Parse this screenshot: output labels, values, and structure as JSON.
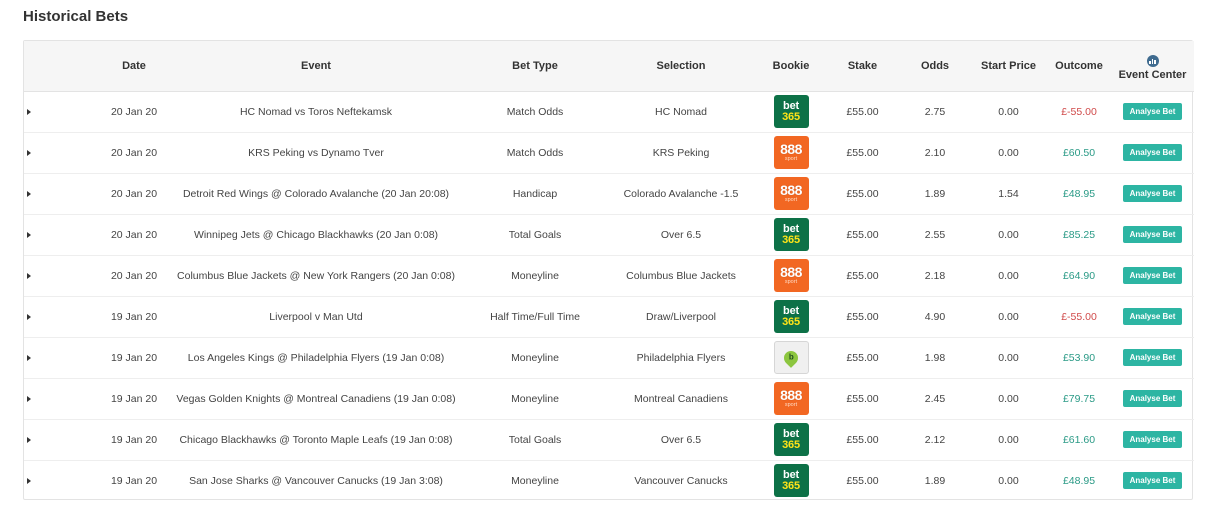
{
  "page": {
    "title": "Historical Bets"
  },
  "table": {
    "headers": {
      "date": "Date",
      "event": "Event",
      "bet_type": "Bet Type",
      "selection": "Selection",
      "bookie": "Bookie",
      "stake": "Stake",
      "odds": "Odds",
      "start_price": "Start Price",
      "outcome": "Outcome",
      "event_center": "Event Center"
    },
    "event_center_icon": "bar-chart-icon",
    "button_label": "Analyse Bet",
    "colors": {
      "negative": "#d04a4a",
      "positive": "#2a9a86",
      "button": "#2db5a3"
    },
    "rows": [
      {
        "date": "20 Jan 20",
        "event": "HC Nomad vs Toros Neftekamsk",
        "bet_type": "Match Odds",
        "selection": "HC Nomad",
        "bookie": "bet365",
        "bookie_l1": "bet",
        "bookie_l2": "365",
        "stake": "£55.00",
        "odds": "2.75",
        "start_price": "0.00",
        "outcome": "£-55.00",
        "outcome_type": "negative"
      },
      {
        "date": "20 Jan 20",
        "event": "KRS Peking vs Dynamo Tver",
        "bet_type": "Match Odds",
        "selection": "KRS Peking",
        "bookie": "888",
        "bookie_l1": "888",
        "bookie_l2": "sport",
        "stake": "£55.00",
        "odds": "2.10",
        "start_price": "0.00",
        "outcome": "£60.50",
        "outcome_type": "positive"
      },
      {
        "date": "20 Jan 20",
        "event": "Detroit Red Wings @ Colorado Avalanche (20 Jan 20:08)",
        "bet_type": "Handicap",
        "selection": "Colorado Avalanche -1.5",
        "bookie": "888",
        "bookie_l1": "888",
        "bookie_l2": "sport",
        "stake": "£55.00",
        "odds": "1.89",
        "start_price": "1.54",
        "outcome": "£48.95",
        "outcome_type": "positive"
      },
      {
        "date": "20 Jan 20",
        "event": "Winnipeg Jets @ Chicago Blackhawks (20 Jan 0:08)",
        "bet_type": "Total Goals",
        "selection": "Over 6.5",
        "bookie": "bet365",
        "bookie_l1": "bet",
        "bookie_l2": "365",
        "stake": "£55.00",
        "odds": "2.55",
        "start_price": "0.00",
        "outcome": "£85.25",
        "outcome_type": "positive"
      },
      {
        "date": "20 Jan 20",
        "event": "Columbus Blue Jackets @ New York Rangers (20 Jan 0:08)",
        "bet_type": "Moneyline",
        "selection": "Columbus Blue Jackets",
        "bookie": "888",
        "bookie_l1": "888",
        "bookie_l2": "sport",
        "stake": "£55.00",
        "odds": "2.18",
        "start_price": "0.00",
        "outcome": "£64.90",
        "outcome_type": "positive"
      },
      {
        "date": "19 Jan 20",
        "event": "Liverpool v Man Utd",
        "bet_type": "Half Time/Full Time",
        "selection": "Draw/Liverpool",
        "bookie": "bet365",
        "bookie_l1": "bet",
        "bookie_l2": "365",
        "stake": "£55.00",
        "odds": "4.90",
        "start_price": "0.00",
        "outcome": "£-55.00",
        "outcome_type": "negative"
      },
      {
        "date": "19 Jan 20",
        "event": "Los Angeles Kings @ Philadelphia Flyers (19 Jan 0:08)",
        "bet_type": "Moneyline",
        "selection": "Philadelphia Flyers",
        "bookie": "pin",
        "bookie_l1": "",
        "bookie_l2": "",
        "stake": "£55.00",
        "odds": "1.98",
        "start_price": "0.00",
        "outcome": "£53.90",
        "outcome_type": "positive"
      },
      {
        "date": "19 Jan 20",
        "event": "Vegas Golden Knights @ Montreal Canadiens (19 Jan 0:08)",
        "bet_type": "Moneyline",
        "selection": "Montreal Canadiens",
        "bookie": "888",
        "bookie_l1": "888",
        "bookie_l2": "sport",
        "stake": "£55.00",
        "odds": "2.45",
        "start_price": "0.00",
        "outcome": "£79.75",
        "outcome_type": "positive"
      },
      {
        "date": "19 Jan 20",
        "event": "Chicago Blackhawks @ Toronto Maple Leafs (19 Jan 0:08)",
        "bet_type": "Total Goals",
        "selection": "Over 6.5",
        "bookie": "bet365",
        "bookie_l1": "bet",
        "bookie_l2": "365",
        "stake": "£55.00",
        "odds": "2.12",
        "start_price": "0.00",
        "outcome": "£61.60",
        "outcome_type": "positive"
      },
      {
        "date": "19 Jan 20",
        "event": "San Jose Sharks @ Vancouver Canucks (19 Jan 3:08)",
        "bet_type": "Moneyline",
        "selection": "Vancouver Canucks",
        "bookie": "bet365",
        "bookie_l1": "bet",
        "bookie_l2": "365",
        "stake": "£55.00",
        "odds": "1.89",
        "start_price": "0.00",
        "outcome": "£48.95",
        "outcome_type": "positive"
      }
    ]
  }
}
